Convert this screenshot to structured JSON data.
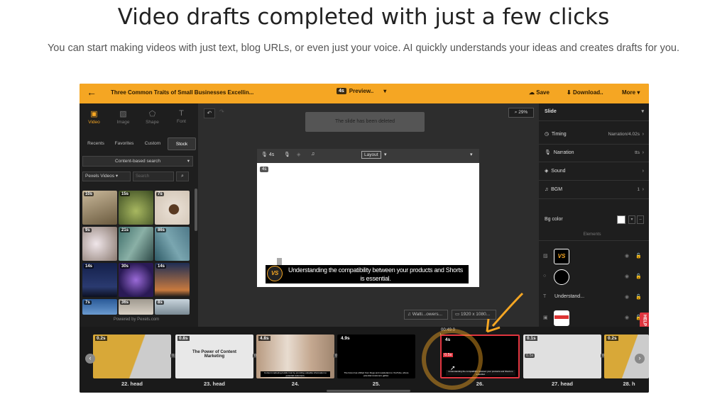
{
  "hero": {
    "title": "Video drafts completed with just a few clicks",
    "subtitle": "You can start making videos with just text, blog URLs, or even just your voice. AI quickly understands your ideas and creates drafts for you."
  },
  "topbar": {
    "back_icon": "arrow-left-icon",
    "project_title": "Three Common Traits of Small Businesses Excellin...",
    "preview_badge": "4s",
    "preview_label": "Preview..",
    "save_label": "Save",
    "download_label": "Download..",
    "more_label": "More",
    "accent": "#f5a623"
  },
  "left_panel": {
    "tool_tabs": [
      {
        "label": "Video",
        "icon": "video-icon",
        "active": true
      },
      {
        "label": "Image",
        "icon": "image-icon",
        "active": false
      },
      {
        "label": "Shape",
        "icon": "shape-icon",
        "active": false
      },
      {
        "label": "Font",
        "icon": "font-icon",
        "active": false
      }
    ],
    "sub_tabs": [
      "Recents",
      "Favorites",
      "Custom",
      "Stock"
    ],
    "active_sub_tab": "Stock",
    "search_mode": "Content-based search",
    "source": "Pexels Videos",
    "search_placeholder": "Search",
    "thumbnails": [
      {
        "duration": "10s",
        "subject": "turtle",
        "color": "#8a7a5c"
      },
      {
        "duration": "15s",
        "subject": "plant sprout",
        "color": "#6d7a4a"
      },
      {
        "duration": "7s",
        "subject": "hands holding plant",
        "color": "#c9b8a6"
      },
      {
        "duration": "9s",
        "subject": "cherry blossoms",
        "color": "#d9c4c9"
      },
      {
        "duration": "21s",
        "subject": "aerial coastline",
        "color": "#4e7a7a"
      },
      {
        "duration": "86s",
        "subject": "aerial river",
        "color": "#5c7c88"
      },
      {
        "duration": "14s",
        "subject": "night mountains",
        "color": "#1f2f55"
      },
      {
        "duration": "30s",
        "subject": "galaxy sky",
        "color": "#3a2a66"
      },
      {
        "duration": "14s",
        "subject": "sunset tree",
        "color": "#2a3a5a"
      },
      {
        "duration": "7s",
        "subject": "blue sky",
        "color": "#3c6ea8"
      },
      {
        "duration": "36s",
        "subject": "flowers",
        "color": "#b8b0a6"
      },
      {
        "duration": "8s",
        "subject": "snowy trees",
        "color": "#9aa8b0"
      }
    ],
    "powered_by": "Powered by Pexels.com"
  },
  "canvas": {
    "zoom": "29%",
    "toast": "The slide has been deleted",
    "toolbar_duration": "4s",
    "layout_label": "Layout",
    "slide_tag": "4s",
    "caption": "Understanding the compatibility between your products and Shorts is essential.",
    "logo_text": "VS",
    "audio_chip": "Walti...owers...",
    "resolution_chip": "1920 x 1080..."
  },
  "right_panel": {
    "header": "Slide",
    "timing_label": "Timing",
    "timing_value": "Narration/4.02s",
    "narration_label": "Narration",
    "narration_value": "tts",
    "sound_label": "Sound",
    "bgm_label": "BGM",
    "bgm_value": "1",
    "bg_color_label": "Bg color",
    "bg_color": "#ffffff",
    "elements_label": "Elements",
    "elements": [
      {
        "kind_icon": "image-icon",
        "name": "",
        "thumb": "VS"
      },
      {
        "kind_icon": "circle-icon",
        "name": "",
        "thumb": ""
      },
      {
        "kind_icon": "text-icon",
        "name": "Understand...",
        "thumb": ""
      },
      {
        "kind_icon": "video-icon",
        "name": "",
        "thumb": ""
      }
    ],
    "help": "HELP"
  },
  "timeline": {
    "current_time": "00:49.0",
    "clips": [
      {
        "label": "22. head",
        "duration": "0.2s",
        "gap": "0.5s",
        "style": "yellow"
      },
      {
        "label": "23. head",
        "duration": "0.8s",
        "gap": "0.5s",
        "style": "white",
        "text": "The Power of Content Marketing"
      },
      {
        "label": "24.",
        "duration": "4.8s",
        "gap": "0.5s",
        "style": "people",
        "text": "Content marketing builds trust by providing valuable information to potential customers."
      },
      {
        "label": "25.",
        "duration": "4.9s",
        "gap": "",
        "style": "dark",
        "text": "The focus has shifted from blogs and newsletters to YouTube, where potential customers gather."
      },
      {
        "label": "26.",
        "duration": "4s",
        "gap": "0.5s",
        "style": "selected",
        "text": "Understanding the compatibility between your products and Shorts is essential."
      },
      {
        "label": "27. head",
        "duration": "0.1s",
        "gap": "0.5s",
        "style": "white"
      },
      {
        "label": "28. h",
        "duration": "0.2s",
        "gap": "",
        "style": "yellow"
      }
    ]
  }
}
